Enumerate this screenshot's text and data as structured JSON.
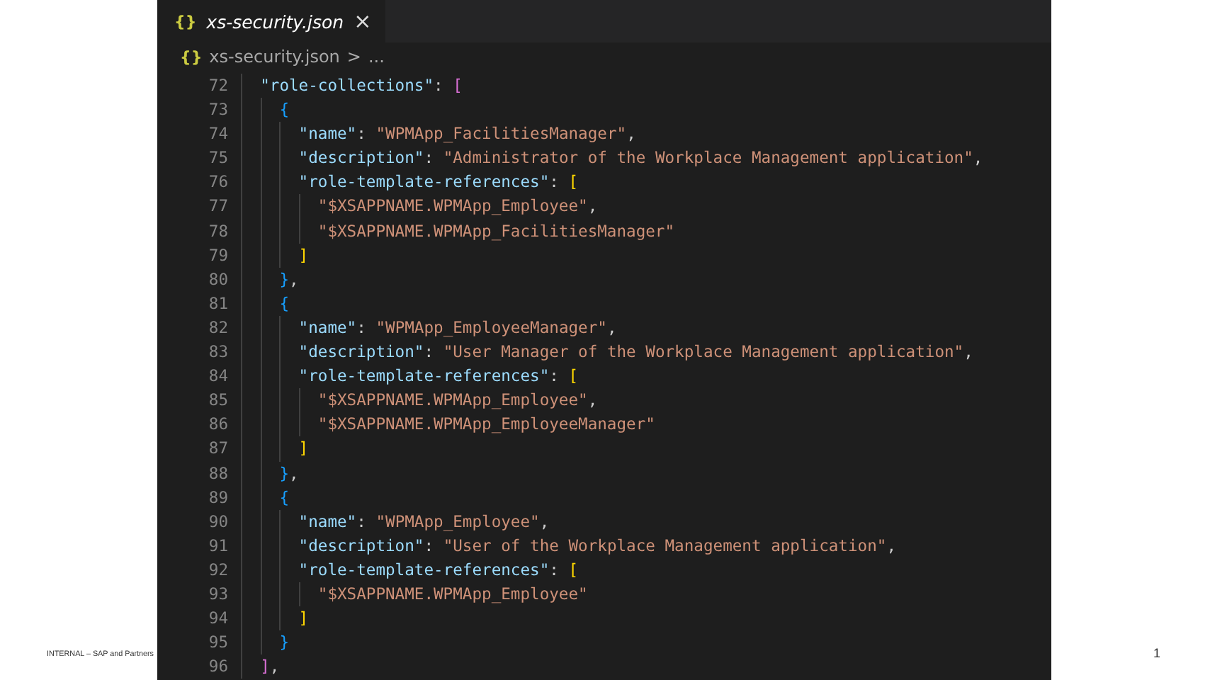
{
  "tab": {
    "icon": "{}",
    "title": "xs-security.json",
    "close": "×",
    "selected": true
  },
  "breadcrumb": {
    "icon": "{}",
    "file": "xs-security.json",
    "separator": ">",
    "rest": "..."
  },
  "lines": [
    {
      "number": "72",
      "tokens": [
        {
          "kind": "key",
          "text": "\"role-collections\""
        },
        {
          "kind": "punct",
          "text": ":"
        },
        {
          "kind": "bracket",
          "text": "[",
          "color": "#da70d6"
        }
      ],
      "children": [
        {
          "number": "73",
          "tokens": [
            {
              "kind": "bracket",
              "text": "{",
              "color": "#179fff"
            }
          ],
          "children": [
            {
              "number": "74",
              "tokens": [
                {
                  "kind": "key",
                  "text": "\"name\""
                },
                {
                  "kind": "punct",
                  "text": ":"
                },
                {
                  "kind": "string",
                  "text": "\"WPMApp_FacilitiesManager\""
                },
                {
                  "kind": "punct",
                  "text": ","
                }
              ]
            },
            {
              "number": "75",
              "tokens": [
                {
                  "kind": "key",
                  "text": "\"description\""
                },
                {
                  "kind": "punct",
                  "text": ":"
                },
                {
                  "kind": "string",
                  "text": "\"Administrator of the Workplace Management application\""
                },
                {
                  "kind": "punct",
                  "text": ","
                }
              ]
            },
            {
              "number": "76",
              "tokens": [
                {
                  "kind": "key",
                  "text": "\"role-template-references\""
                },
                {
                  "kind": "punct",
                  "text": ":"
                },
                {
                  "kind": "bracket",
                  "text": "[",
                  "color": "#ffd700"
                }
              ],
              "children": [
                {
                  "number": "77",
                  "tokens": [
                    {
                      "kind": "string",
                      "text": "\"$XSAPPNAME.WPMApp_Employee\""
                    },
                    {
                      "kind": "punct",
                      "text": ","
                    }
                  ]
                },
                {
                  "number": "78",
                  "tokens": [
                    {
                      "kind": "string",
                      "text": "\"$XSAPPNAME.WPMApp_FacilitiesManager\""
                    }
                  ]
                }
              ]
            },
            {
              "number": "79",
              "tokens": [
                {
                  "kind": "bracket",
                  "text": "]",
                  "color": "#ffd700"
                }
              ]
            }
          ]
        },
        {
          "number": "80",
          "tokens": [
            {
              "kind": "bracket",
              "text": "}",
              "color": "#179fff"
            },
            {
              "kind": "punct",
              "text": ","
            }
          ]
        },
        {
          "number": "81",
          "tokens": [
            {
              "kind": "bracket",
              "text": "{",
              "color": "#179fff"
            }
          ],
          "children": [
            {
              "number": "82",
              "tokens": [
                {
                  "kind": "key",
                  "text": "\"name\""
                },
                {
                  "kind": "punct",
                  "text": ":"
                },
                {
                  "kind": "string",
                  "text": "\"WPMApp_EmployeeManager\""
                },
                {
                  "kind": "punct",
                  "text": ","
                }
              ]
            },
            {
              "number": "83",
              "tokens": [
                {
                  "kind": "key",
                  "text": "\"description\""
                },
                {
                  "kind": "punct",
                  "text": ":"
                },
                {
                  "kind": "string",
                  "text": "\"User Manager of the Workplace Management application\""
                },
                {
                  "kind": "punct",
                  "text": ","
                }
              ]
            },
            {
              "number": "84",
              "tokens": [
                {
                  "kind": "key",
                  "text": "\"role-template-references\""
                },
                {
                  "kind": "punct",
                  "text": ":"
                },
                {
                  "kind": "bracket",
                  "text": "[",
                  "color": "#ffd700"
                }
              ],
              "children": [
                {
                  "number": "85",
                  "tokens": [
                    {
                      "kind": "string",
                      "text": "\"$XSAPPNAME.WPMApp_Employee\""
                    },
                    {
                      "kind": "punct",
                      "text": ","
                    }
                  ]
                },
                {
                  "number": "86",
                  "tokens": [
                    {
                      "kind": "string",
                      "text": "\"$XSAPPNAME.WPMApp_EmployeeManager\""
                    }
                  ]
                }
              ]
            },
            {
              "number": "87",
              "tokens": [
                {
                  "kind": "bracket",
                  "text": "]",
                  "color": "#ffd700"
                }
              ]
            }
          ]
        },
        {
          "number": "88",
          "tokens": [
            {
              "kind": "bracket",
              "text": "}",
              "color": "#179fff"
            },
            {
              "kind": "punct",
              "text": ","
            }
          ]
        },
        {
          "number": "89",
          "tokens": [
            {
              "kind": "bracket",
              "text": "{",
              "color": "#179fff"
            }
          ],
          "children": [
            {
              "number": "90",
              "tokens": [
                {
                  "kind": "key",
                  "text": "\"name\""
                },
                {
                  "kind": "punct",
                  "text": ":"
                },
                {
                  "kind": "string",
                  "text": "\"WPMApp_Employee\""
                },
                {
                  "kind": "punct",
                  "text": ","
                }
              ]
            },
            {
              "number": "91",
              "tokens": [
                {
                  "kind": "key",
                  "text": "\"description\""
                },
                {
                  "kind": "punct",
                  "text": ":"
                },
                {
                  "kind": "string",
                  "text": "\"User of the Workplace Management application\""
                },
                {
                  "kind": "punct",
                  "text": ","
                }
              ]
            },
            {
              "number": "92",
              "tokens": [
                {
                  "kind": "key",
                  "text": "\"role-template-references\""
                },
                {
                  "kind": "punct",
                  "text": ":"
                },
                {
                  "kind": "bracket",
                  "text": "[",
                  "color": "#ffd700"
                }
              ],
              "children": [
                {
                  "number": "93",
                  "tokens": [
                    {
                      "kind": "string",
                      "text": "\"$XSAPPNAME.WPMApp_Employee\""
                    }
                  ]
                }
              ]
            },
            {
              "number": "94",
              "tokens": [
                {
                  "kind": "bracket",
                  "text": "]",
                  "color": "#ffd700"
                }
              ]
            }
          ]
        },
        {
          "number": "95",
          "tokens": [
            {
              "kind": "bracket",
              "text": "}",
              "color": "#179fff"
            }
          ]
        }
      ]
    },
    {
      "number": "96",
      "tokens": [
        {
          "kind": "bracket",
          "text": "]",
          "color": "#da70d6"
        },
        {
          "kind": "punct",
          "text": ","
        }
      ]
    }
  ],
  "footer": {
    "classification": "INTERNAL – SAP and Partners",
    "page_number": "1"
  }
}
